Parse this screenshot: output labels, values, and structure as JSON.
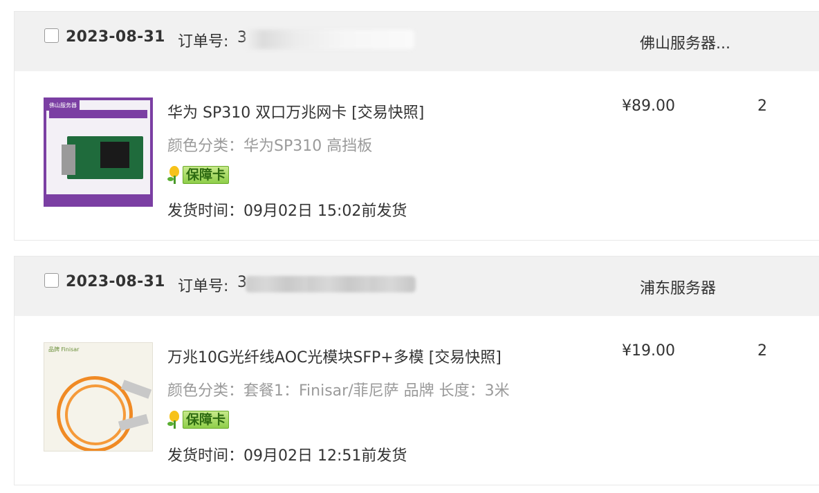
{
  "orders": [
    {
      "date": "2023-08-31",
      "order_label": "订单号:",
      "order_number_visible": "3",
      "shop": "佛山服务器...",
      "item": {
        "image_icon": "network-card-product-image",
        "title": "华为 SP310 双口万兆网卡 [交易快照]",
        "spec": "颜色分类：华为SP310 高挡板",
        "badge": "保障卡",
        "ship_time": "发货时间：09月02日 15:02前发货",
        "price": "¥89.00",
        "quantity": "2"
      }
    },
    {
      "date": "2023-08-31",
      "order_label": "订单号:",
      "order_number_visible": "3",
      "shop": "浦东服务器",
      "item": {
        "image_icon": "aoc-cable-product-image",
        "title": "万兆10G光纤线AOC光模块SFP+多模 [交易快照]",
        "spec": "颜色分类：套餐1：Finisar/菲尼萨 品牌 长度：3米",
        "badge": "保障卡",
        "ship_time": "发货时间：09月02日 12:51前发货",
        "price": "¥19.00",
        "quantity": "2"
      }
    }
  ],
  "colors": {
    "header_bg": "#f1f1f1",
    "muted_text": "#9a9a9a",
    "badge_green": "#8fce4a"
  }
}
